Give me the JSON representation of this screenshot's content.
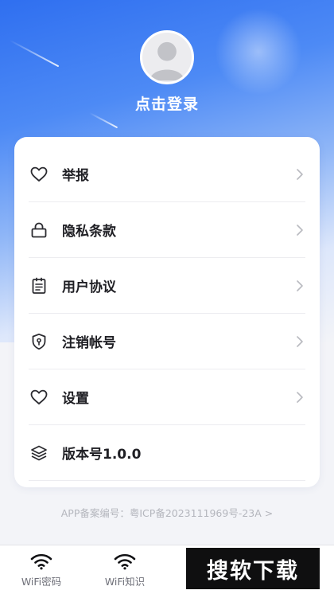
{
  "profile": {
    "login_label": "点击登录"
  },
  "menu": {
    "items": [
      {
        "label": "举报",
        "icon": "heart-icon"
      },
      {
        "label": "隐私条款",
        "icon": "lock-icon"
      },
      {
        "label": "用户协议",
        "icon": "clipboard-icon"
      },
      {
        "label": "注销帐号",
        "icon": "shield-icon"
      },
      {
        "label": "设置",
        "icon": "heart-icon"
      },
      {
        "label": "版本号1.0.0",
        "icon": "layers-icon"
      }
    ]
  },
  "footer": {
    "icp_text": "APP备案编号：粤ICP备2023111969号-23A >"
  },
  "tabbar": {
    "tabs": [
      {
        "label": "WiFi密码",
        "icon": "wifi-icon"
      },
      {
        "label": "WiFi知识",
        "icon": "wifi-icon"
      }
    ]
  },
  "watermark": {
    "text": "搜软下载"
  },
  "colors": {
    "accent": "#3a78f2",
    "text_primary": "#1f1f24",
    "text_muted": "#b4b6bd"
  }
}
